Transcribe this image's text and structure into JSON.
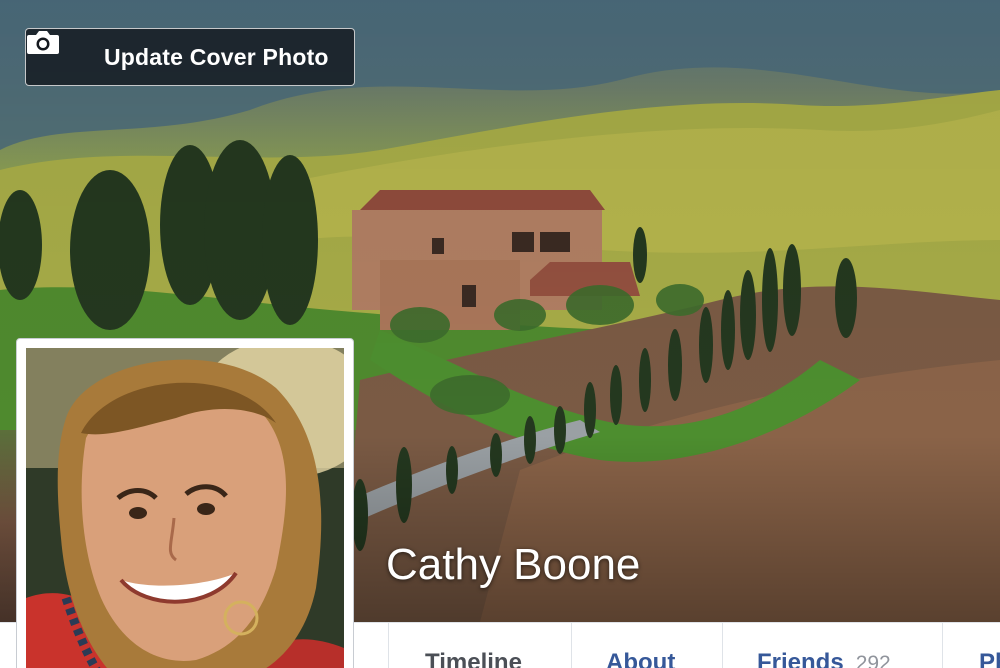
{
  "cover": {
    "update_button_label": "Update Cover Photo",
    "update_button_icon": "camera-icon"
  },
  "profile": {
    "name": "Cathy Boone"
  },
  "nav": {
    "tabs": [
      {
        "label": "Timeline"
      },
      {
        "label": "About"
      },
      {
        "label": "Friends",
        "count": "292"
      },
      {
        "label": "Ph"
      }
    ]
  },
  "colors": {
    "link_blue": "#365899",
    "tab_text_gray": "#4b4f56",
    "count_gray": "#90949c",
    "button_bg": "#14181e"
  }
}
